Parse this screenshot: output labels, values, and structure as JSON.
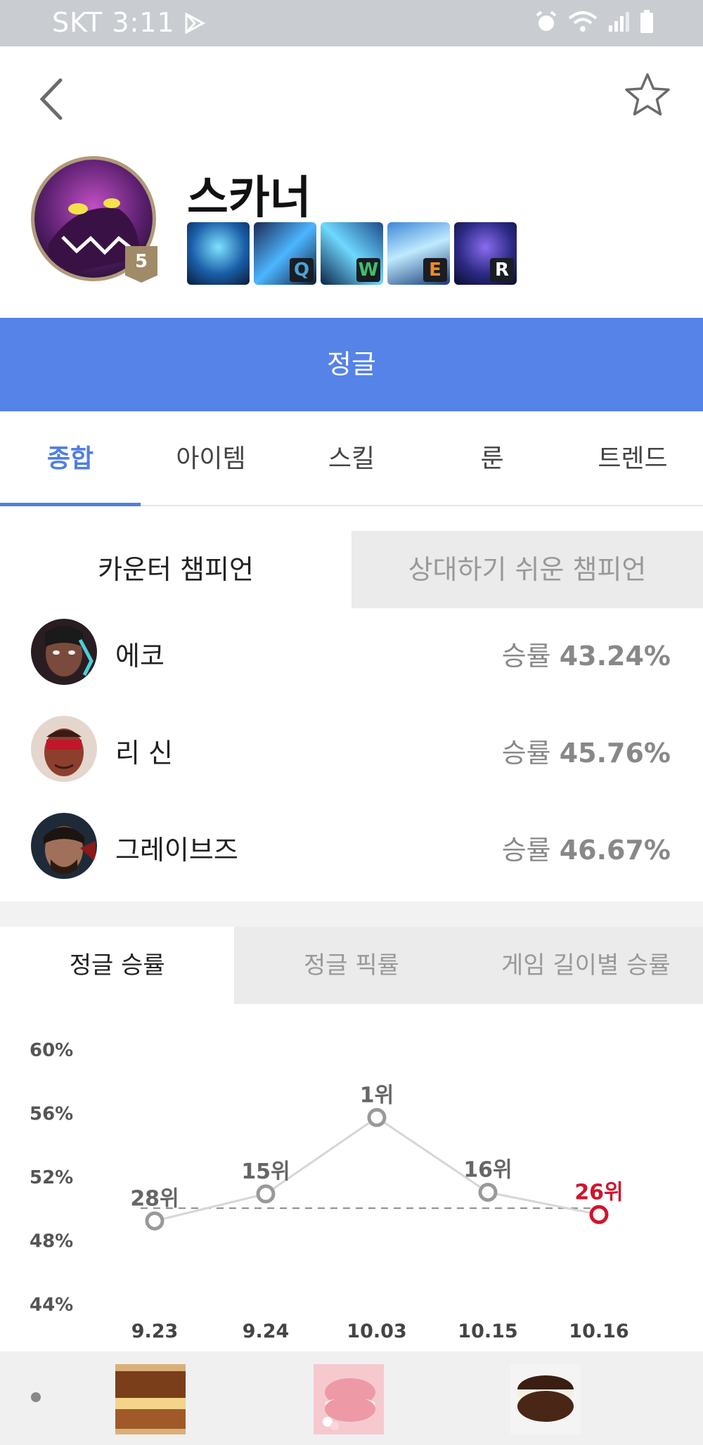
{
  "status": {
    "carrier": "SKT 3:11"
  },
  "champion": {
    "name": "스카너",
    "level": "5"
  },
  "skills": [
    {
      "key": ""
    },
    {
      "key": "Q",
      "key_color": "#49a4d8"
    },
    {
      "key": "W",
      "key_color": "#3fbf6a"
    },
    {
      "key": "E",
      "key_color": "#f08a24"
    },
    {
      "key": "R",
      "key_color": "#ffffff"
    }
  ],
  "role": "정글",
  "tabs": [
    "종합",
    "아이템",
    "스킬",
    "룬",
    "트렌드"
  ],
  "counter_tabs": [
    "카운터 챔피언",
    "상대하기 쉬운 챔피언"
  ],
  "counters": [
    {
      "name": "에코",
      "win_label": "승률",
      "win_value": "43.24%"
    },
    {
      "name": "리 신",
      "win_label": "승률",
      "win_value": "45.76%"
    },
    {
      "name": "그레이브즈",
      "win_label": "승률",
      "win_value": "46.67%"
    }
  ],
  "stat_tabs": [
    "정글 승률",
    "정글 픽률",
    "게임 길이별 승률"
  ],
  "colors": {
    "accent": "#4f7fe0",
    "role_bar": "#5583e8",
    "highlight": "#d0142c"
  },
  "chart_data": {
    "type": "line",
    "title": "",
    "x": [
      "9.23",
      "9.24",
      "10.03",
      "10.15",
      "10.16"
    ],
    "y_ticks": [
      "60%",
      "56%",
      "52%",
      "48%",
      "44%"
    ],
    "ylim": [
      44,
      60
    ],
    "series": [
      {
        "values": [
          49.2,
          50.9,
          55.7,
          51.0,
          49.6
        ]
      }
    ],
    "rank_labels": [
      "28위",
      "15위",
      "1위",
      "16위",
      "26위"
    ],
    "reference_line": 50.0,
    "highlight_index": 4
  }
}
